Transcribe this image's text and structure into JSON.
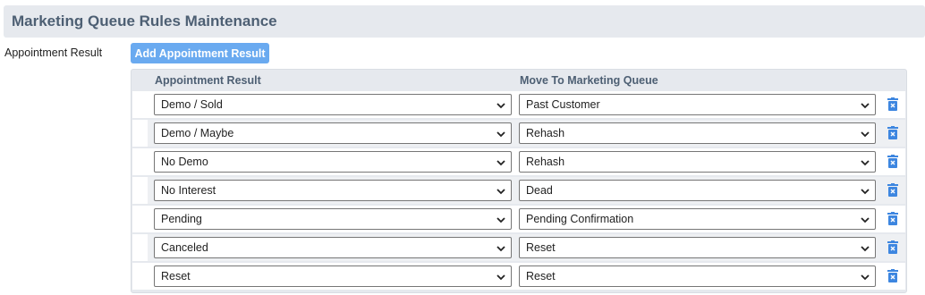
{
  "header": {
    "title": "Marketing Queue Rules Maintenance"
  },
  "form": {
    "label": "Appointment Result",
    "add_button_label": "Add Appointment Result"
  },
  "table": {
    "columns": [
      "Appointment Result",
      "Move To Marketing Queue"
    ],
    "rows": [
      {
        "result": "Demo / Sold",
        "queue": "Past Customer"
      },
      {
        "result": "Demo / Maybe",
        "queue": "Rehash"
      },
      {
        "result": "No Demo",
        "queue": "Rehash"
      },
      {
        "result": "No Interest",
        "queue": "Dead"
      },
      {
        "result": "Pending",
        "queue": "Pending Confirmation"
      },
      {
        "result": "Canceled",
        "queue": "Reset"
      },
      {
        "result": "Reset",
        "queue": "Reset"
      }
    ]
  },
  "colors": {
    "accent": "#6aaaf0",
    "header_text": "#4d5f73",
    "delete_icon": "#3d86e0"
  },
  "icons": {
    "row_delete": "trash-icon",
    "select_toggle": "chevron-down-icon"
  }
}
